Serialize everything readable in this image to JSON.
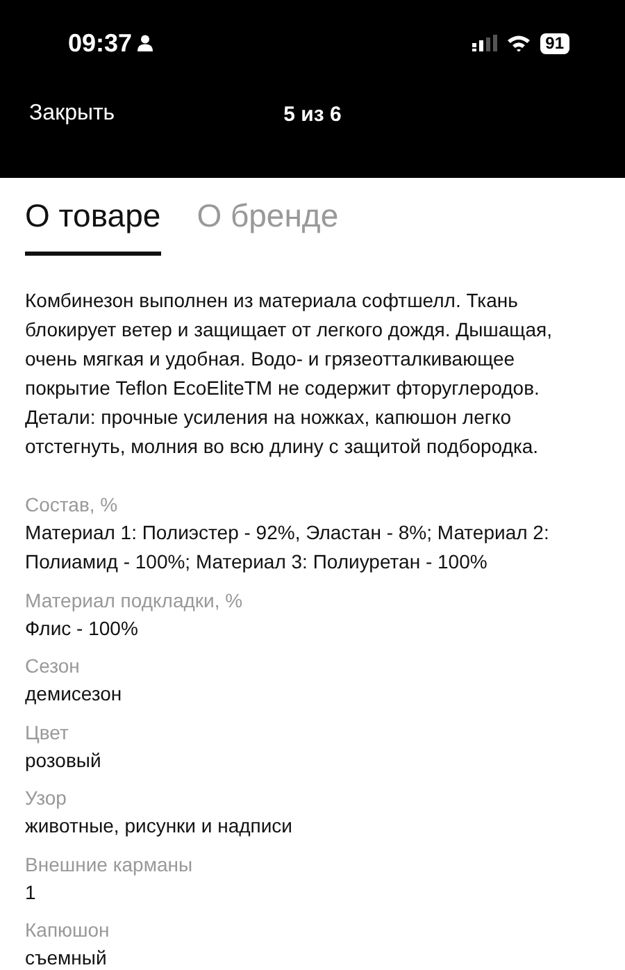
{
  "status_bar": {
    "time": "09:37",
    "battery": "91"
  },
  "nav": {
    "close": "Закрыть",
    "title": "5 из 6"
  },
  "tabs": [
    {
      "label": "О товаре",
      "selected": true
    },
    {
      "label": "О бренде",
      "selected": false
    }
  ],
  "description": "Комбинезон выполнен из материала софтшелл. Ткань блокирует ветер и защищает от легкого дождя. Дышащая, очень мягкая и удобная. Водо- и грязеотталкивающее покрытие Teflon EcoEliteTM не содержит фторуглеродов. Детали: прочные усиления на ножках, капюшон легко отстегнуть, молния во всю длину с защитой подбородка.",
  "attributes": [
    {
      "label": "Состав, %",
      "value": "Материал 1: Полиэстер - 92%, Эластан - 8%; Материал 2: Полиамид - 100%; Материал 3: Полиуретан - 100%"
    },
    {
      "label": "Материал подкладки, %",
      "value": "Флис - 100%"
    },
    {
      "label": "Сезон",
      "value": "демисезон"
    },
    {
      "label": "Цвет",
      "value": "розовый"
    },
    {
      "label": "Узор",
      "value": "животные, рисунки и надписи"
    },
    {
      "label": "Внешние карманы",
      "value": "1"
    },
    {
      "label": "Капюшон",
      "value": "съемный"
    }
  ]
}
